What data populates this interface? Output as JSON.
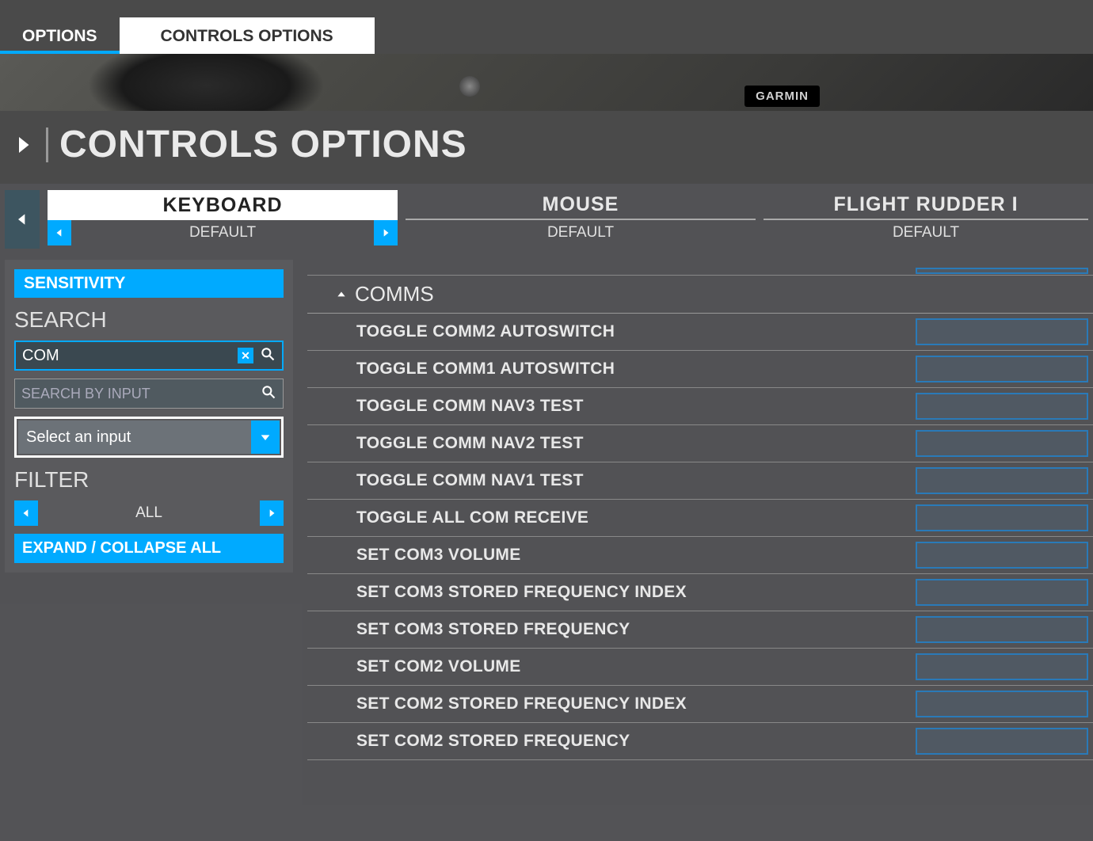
{
  "tabs": {
    "options": "OPTIONS",
    "controls_options": "CONTROLS OPTIONS"
  },
  "page_title": "CONTROLS OPTIONS",
  "garmin": "GARMIN",
  "devices": [
    {
      "name": "KEYBOARD",
      "preset": "DEFAULT"
    },
    {
      "name": "MOUSE",
      "preset": "DEFAULT"
    },
    {
      "name": "FLIGHT RUDDER I",
      "preset": "DEFAULT"
    }
  ],
  "sidebar": {
    "sensitivity": "SENSITIVITY",
    "search_heading": "SEARCH",
    "search_name_value": "COM",
    "search_input_placeholder": "SEARCH BY INPUT",
    "select_input_label": "Select an input",
    "filter_heading": "FILTER",
    "filter_value": "ALL",
    "expand_collapse": "EXPAND / COLLAPSE ALL"
  },
  "category": "COMMS",
  "bindings": [
    "TOGGLE COMM2 AUTOSWITCH",
    "TOGGLE COMM1 AUTOSWITCH",
    "TOGGLE COMM NAV3 TEST",
    "TOGGLE COMM NAV2 TEST",
    "TOGGLE COMM NAV1 TEST",
    "TOGGLE ALL COM RECEIVE",
    "SET COM3 VOLUME",
    "SET COM3 STORED FREQUENCY INDEX",
    "SET COM3 STORED FREQUENCY",
    "SET COM2 VOLUME",
    "SET COM2 STORED FREQUENCY INDEX",
    "SET COM2 STORED FREQUENCY"
  ]
}
